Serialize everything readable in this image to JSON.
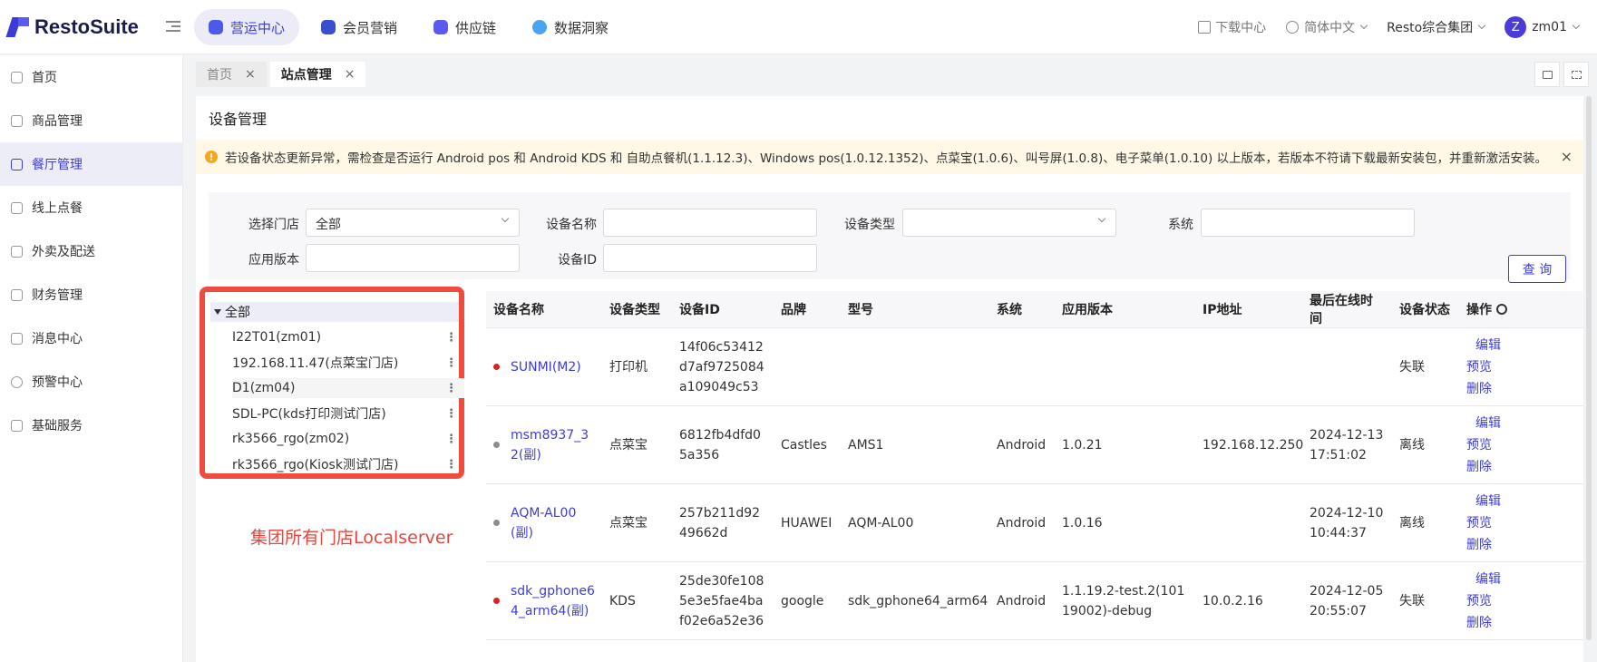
{
  "app": {
    "logo": "RestoSuite"
  },
  "nav": {
    "tabs": [
      {
        "label": "营运中心",
        "color": "#4b5be8"
      },
      {
        "label": "会员营销",
        "color": "#3a4fd0"
      },
      {
        "label": "供应链",
        "color": "#5a5af0"
      },
      {
        "label": "数据洞察",
        "color": "#4aa4f0"
      }
    ]
  },
  "topright": {
    "download": "下载中心",
    "language": "简体中文",
    "org": "Resto综合集团",
    "avatar_letter": "Z",
    "user": "zm01"
  },
  "sidebar": {
    "items": [
      {
        "label": "首页"
      },
      {
        "label": "商品管理"
      },
      {
        "label": "餐厅管理"
      },
      {
        "label": "线上点餐"
      },
      {
        "label": "外卖及配送"
      },
      {
        "label": "财务管理"
      },
      {
        "label": "消息中心"
      },
      {
        "label": "预警中心"
      },
      {
        "label": "基础服务"
      }
    ]
  },
  "pagetabs": {
    "tabs": [
      {
        "label": "首页",
        "close": "×"
      },
      {
        "label": "站点管理",
        "close": "×"
      }
    ]
  },
  "page": {
    "title": "设备管理",
    "alert": "若设备状态更新异常，需检查是否运行 Android pos 和 Android KDS 和 自助点餐机(1.1.12.3)、Windows pos(1.0.12.1352)、点菜宝(1.0.6)、叫号屏(1.0.8)、电子菜单(1.0.10) 以上版本，若版本不符请下载最新安装包，并重新激活安装。",
    "alert_icon": "!",
    "alert_close": "×"
  },
  "filters": {
    "store_label": "选择门店",
    "store_value": "全部",
    "name_label": "设备名称",
    "type_label": "设备类型",
    "system_label": "系统",
    "version_label": "应用版本",
    "id_label": "设备ID",
    "query": "查 询"
  },
  "tree": {
    "root": "全部",
    "nodes": [
      "I22T01(zm01)",
      "192.168.11.47(点菜宝门店)",
      "D1(zm04)",
      "SDL-PC(kds打印测试门店)",
      "rk3566_rgo(zm02)",
      "rk3566_rgo(Kiosk测试门店)"
    ],
    "dots": "⋮",
    "annotation": "集团所有门店Localserver"
  },
  "table": {
    "headers": [
      "设备名称",
      "设备类型",
      "设备ID",
      "品牌",
      "型号",
      "系统",
      "应用版本",
      "IP地址",
      "最后在线时间",
      "设备状态",
      "操作"
    ],
    "rows": [
      {
        "status_color": "#e02020",
        "name": "SUNMI(M2)",
        "type": "打印机",
        "id": "14f06c53412d7af9725084a109049c53",
        "brand": "",
        "model": "",
        "system": "",
        "version": "",
        "ip": "",
        "last_online": "",
        "status": "失联"
      },
      {
        "status_color": "#8c8c8c",
        "name": "msm8937_32(副)",
        "type": "点菜宝",
        "id": "6812fb4dfd05a356",
        "brand": "Castles",
        "model": "AMS1",
        "system": "Android",
        "version": "1.0.21",
        "ip": "192.168.12.250",
        "last_online": "2024-12-13 17:51:02",
        "status": "离线"
      },
      {
        "status_color": "#8c8c8c",
        "name": "AQM-AL00(副)",
        "type": "点菜宝",
        "id": "257b211d9249662d",
        "brand": "HUAWEI",
        "model": "AQM-AL00",
        "system": "Android",
        "version": "1.0.16",
        "ip": "",
        "last_online": "2024-12-10 10:44:37",
        "status": "离线"
      },
      {
        "status_color": "#e02020",
        "name": "sdk_gphone64_arm64(副)",
        "type": "KDS",
        "id": "25de30fe1085e3e5fae4baf02e6a52e36",
        "brand": "google",
        "model": "sdk_gphone64_arm64",
        "system": "Android",
        "version": "1.1.19.2-test.2(10119002)-debug",
        "ip": "10.0.2.16",
        "last_online": "2024-12-05 20:55:07",
        "status": "失联"
      }
    ],
    "ops": {
      "edit": "编辑",
      "preview": "预览",
      "delete": "删除"
    }
  }
}
